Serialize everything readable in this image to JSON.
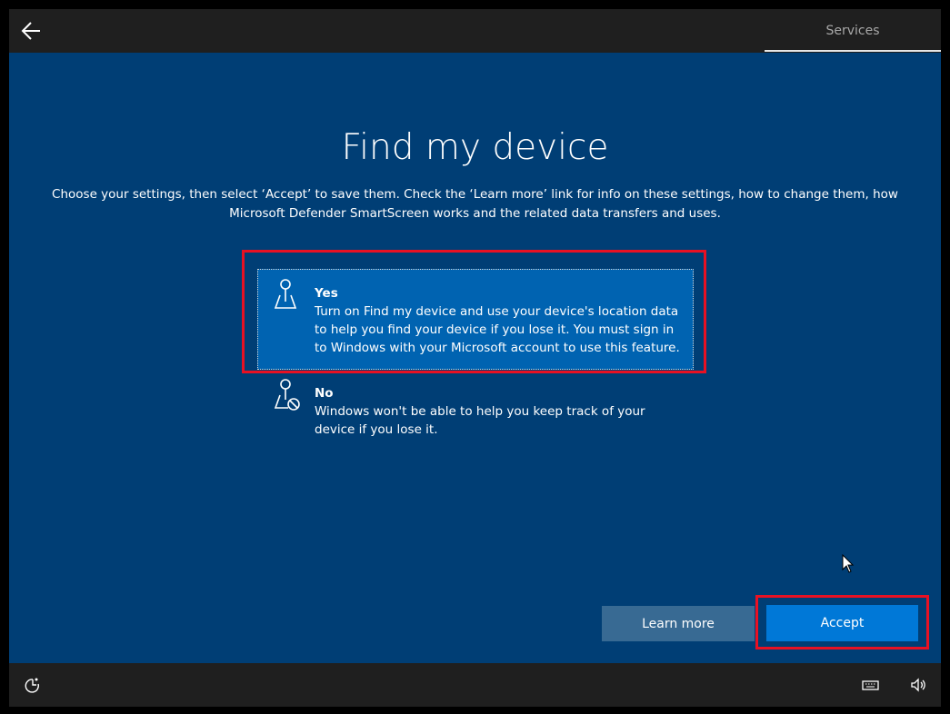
{
  "header": {
    "back_icon": "arrow-left-icon",
    "tab_label": "Services"
  },
  "main": {
    "title": "Find my device",
    "description": "Choose your settings, then select ‘Accept’ to save them. Check the ‘Learn more’ link for info on these settings, how to change them, how Microsoft Defender SmartScreen works and the related data transfers and uses.",
    "options": [
      {
        "icon": "location-pin-icon",
        "heading": "Yes",
        "text": "Turn on Find my device and use your device's location data to help you find your device if you lose it. You must sign in to Windows with your Microsoft account to use this feature.",
        "selected": true
      },
      {
        "icon": "location-pin-blocked-icon",
        "heading": "No",
        "text": "Windows won't be able to help you keep track of your device if you lose it.",
        "selected": false
      }
    ],
    "learn_more_label": "Learn more",
    "accept_label": "Accept"
  },
  "footer": {
    "icons": [
      "ease-of-access-icon",
      "keyboard-icon",
      "volume-icon"
    ]
  },
  "colors": {
    "background": "#003e75",
    "bar": "#1f1f1f",
    "selected_option": "#0063b1",
    "accept_button": "#0078d7",
    "learn_more_button": "#386a93",
    "highlight": "#e81123"
  }
}
